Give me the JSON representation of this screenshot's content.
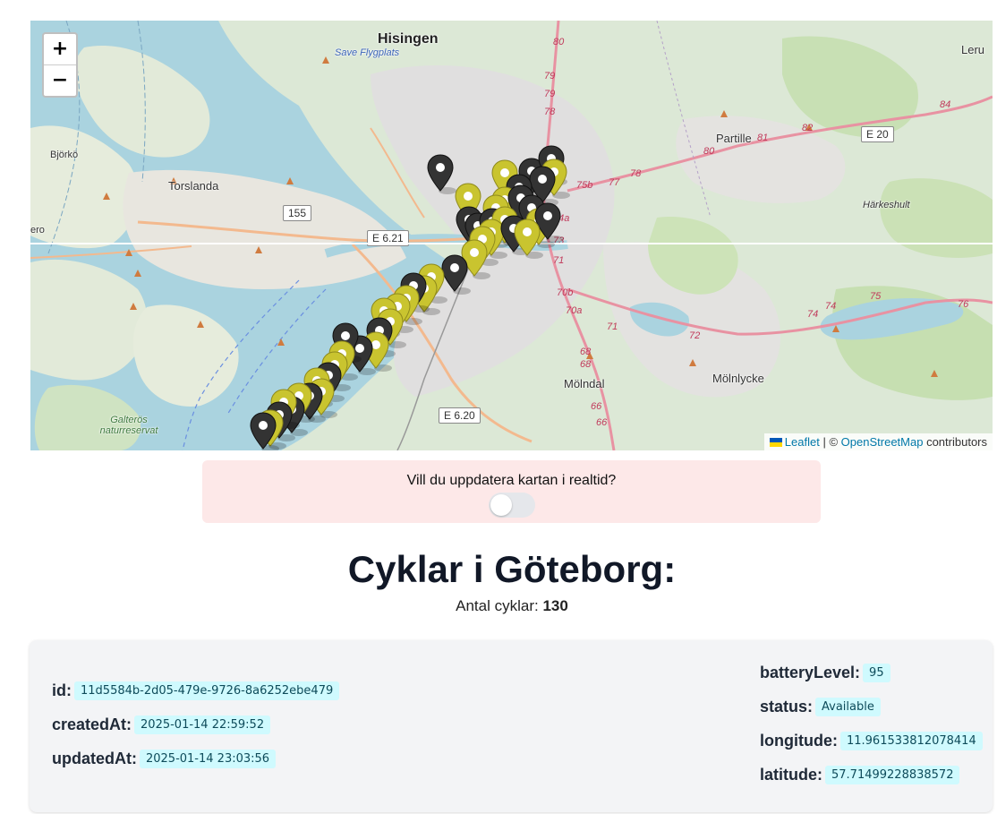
{
  "map": {
    "zoom_in": "+",
    "zoom_out": "−",
    "places": {
      "hisingen": "Hisingen",
      "save": "Save Flygplats",
      "leru": "Leru",
      "bjorko": "Björkö",
      "torslanda": "Torslanda",
      "partille": "Partille",
      "harkeshult": "Härkeshult",
      "molndal": "Mölndal",
      "molnlycke": "Mölnlycke",
      "galteros": "Galterös naturreservat",
      "ero": "ero"
    },
    "shields": {
      "r155": "155",
      "e621": "E 6.21",
      "e620": "E 6.20",
      "e20": "E 20"
    },
    "route_numbers": [
      "80",
      "79",
      "79",
      "78",
      "77",
      "78",
      "75b",
      "74a",
      "73",
      "71",
      "70b",
      "70a",
      "71",
      "72",
      "68",
      "68",
      "66",
      "66",
      "81",
      "82",
      "84",
      "75",
      "76",
      "74",
      "74",
      "80"
    ],
    "attribution": {
      "leaflet": "Leaflet",
      "sep": "| ©",
      "osm": "OpenStreetMap",
      "tail": "contributors"
    }
  },
  "realtime": {
    "question": "Vill du uppdatera kartan i realtid?",
    "enabled": false
  },
  "title": "Cyklar i Göteborg:",
  "count": {
    "label": "Antal cyklar:",
    "value": "130"
  },
  "bike": {
    "id_label": "id:",
    "id": "11d5584b-2d05-479e-9726-8a6252ebe479",
    "created_label": "createdAt:",
    "created": "2025-01-14 22:59:52",
    "updated_label": "updatedAt:",
    "updated": "2025-01-14 23:03:56",
    "battery_label": "batteryLevel:",
    "battery": "95",
    "status_label": "status:",
    "status": "Available",
    "lon_label": "longitude:",
    "lon": "11.961533812078414",
    "lat_label": "latitude:",
    "lat": "57.71499228838572"
  },
  "colors": {
    "marker_yellow": "#c9c42f",
    "marker_dark": "#333333",
    "badge_bg": "#cffafe",
    "realtime_bg": "#fde8e8"
  }
}
